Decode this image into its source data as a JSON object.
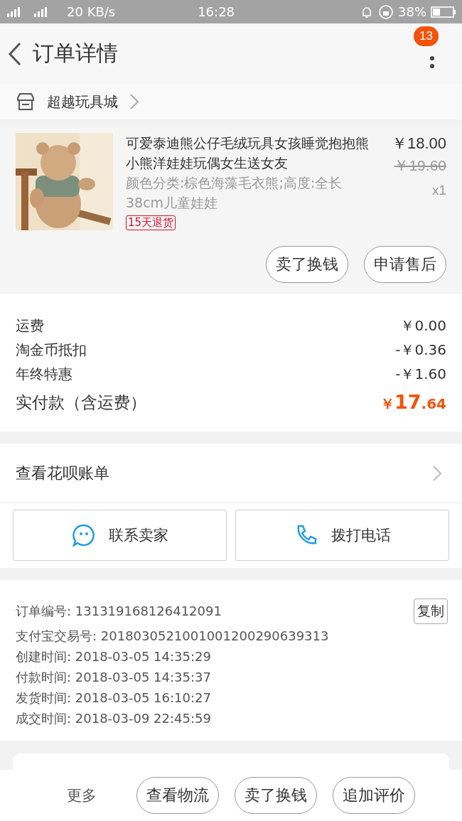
{
  "status_bar": {
    "left": "20 KB/s",
    "time": "16:28",
    "battery": "38%"
  },
  "header": {
    "title": "订单详情",
    "badge": "13"
  },
  "shop": {
    "name": "超越玩具城"
  },
  "product": {
    "title": "可爱泰迪熊公仔毛绒玩具女孩睡觉抱抱熊小熊洋娃娃玩偶女生送女友",
    "spec": "颜色分类:棕色海藻毛衣熊;高度:全长38cm儿童娃娃",
    "tag": "15天退货",
    "price": "￥18.00",
    "original_price": "￥19.60",
    "quantity": "x1",
    "buttons": [
      "卖了换钱",
      "申请售后"
    ]
  },
  "costs": [
    {
      "label": "运费",
      "value": "￥0.00"
    },
    {
      "label": "淘金币抵扣",
      "value": "-￥0.36"
    },
    {
      "label": "年终特惠",
      "value": "-￥1.60"
    }
  ],
  "total": {
    "label": "实付款（含运费）",
    "currency": "￥",
    "integer": "17",
    "decimal": ".64"
  },
  "huabei": {
    "label": "查看花呗账单"
  },
  "contact": [
    {
      "kind": "chat",
      "label": "联系卖家"
    },
    {
      "kind": "phone",
      "label": "拨打电话"
    }
  ],
  "info": [
    {
      "label": "订单编号:",
      "value": "131319168126412091"
    },
    {
      "label": "支付宝交易号:",
      "value": "2018030521001001200290639313"
    },
    {
      "label": "创建时间:",
      "value": "2018-03-05 14:35:29"
    },
    {
      "label": "付款时间:",
      "value": "2018-03-05 14:35:37"
    },
    {
      "label": "发货时间:",
      "value": "2018-03-05 16:10:27"
    },
    {
      "label": "成交时间:",
      "value": "2018-03-09 22:45:59"
    }
  ],
  "copy_button": "复制",
  "bottom_bar": {
    "more": "更多",
    "buttons": [
      "查看物流",
      "卖了换钱",
      "追加评价"
    ]
  }
}
